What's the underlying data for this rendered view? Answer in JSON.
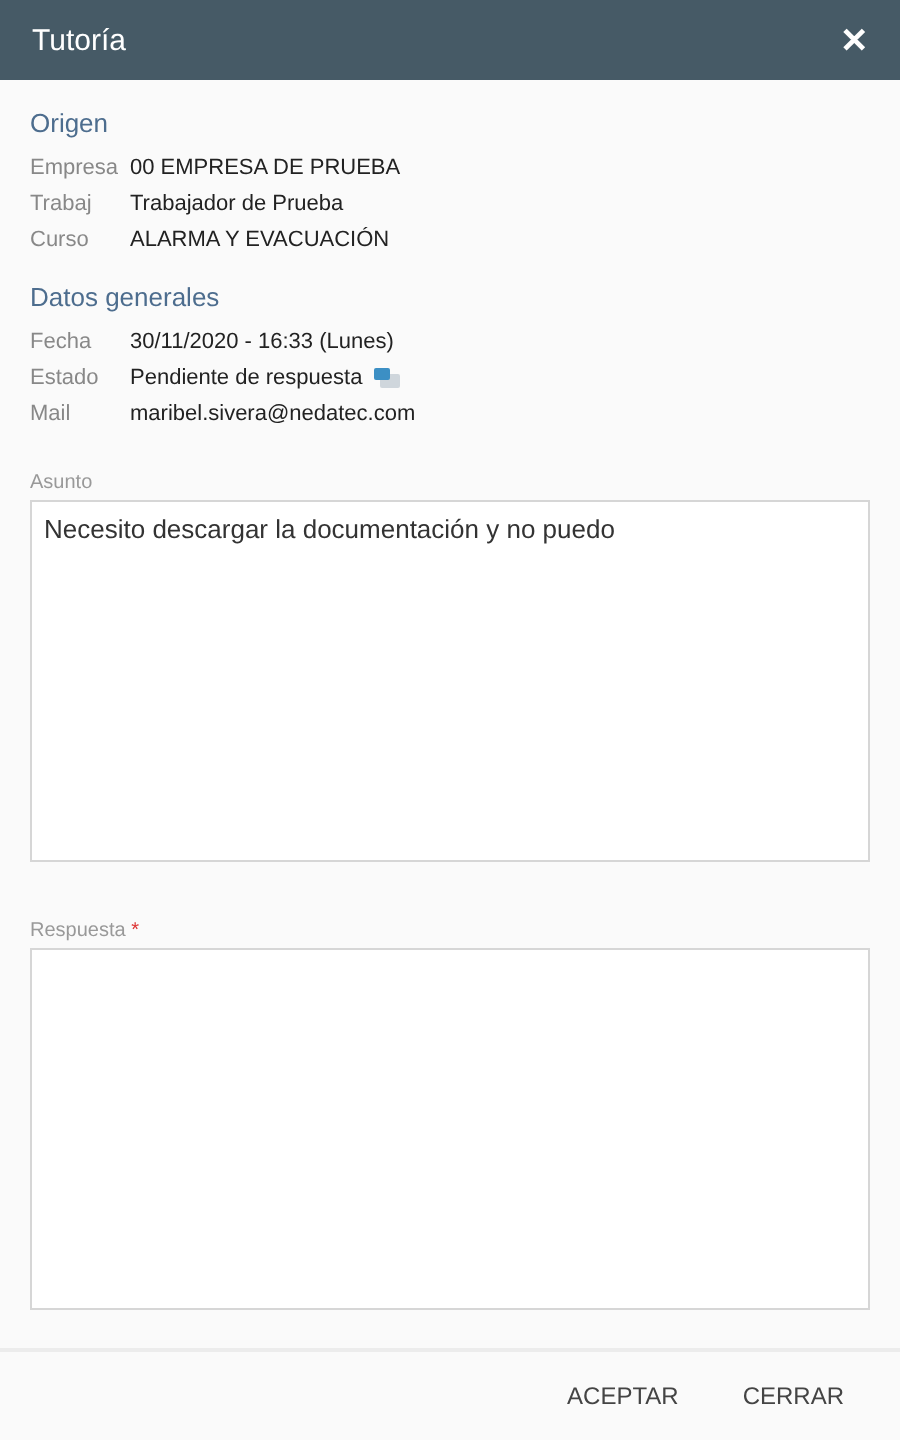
{
  "window": {
    "title": "Tutoría",
    "close": "✕"
  },
  "sections": [
    {
      "heading": "Origen",
      "rows": [
        {
          "label": "Empresa",
          "value": "00 EMPRESA DE PRUEBA"
        },
        {
          "label": "Trabaj",
          "value": "Trabajador de Prueba"
        },
        {
          "label": "Curso",
          "value": "ALARMA Y EVACUACIÓN"
        }
      ]
    },
    {
      "heading": "Datos generales",
      "rows": [
        {
          "label": "Fecha",
          "value": "30/11/2020 - 16:33 (Lunes)"
        },
        {
          "label": "Estado",
          "value": "Pendiente de respuesta",
          "kind": "status"
        },
        {
          "label": "Mail",
          "value": "maribel.sivera@nedatec.com"
        }
      ]
    }
  ],
  "fields": [
    {
      "label": "Asunto",
      "value": "Necesito descargar la documentación y no puedo"
    },
    {
      "label": "Respuesta",
      "required_mark": "*"
    }
  ],
  "buttons": [
    "ACEPTAR",
    "CERRAR"
  ]
}
